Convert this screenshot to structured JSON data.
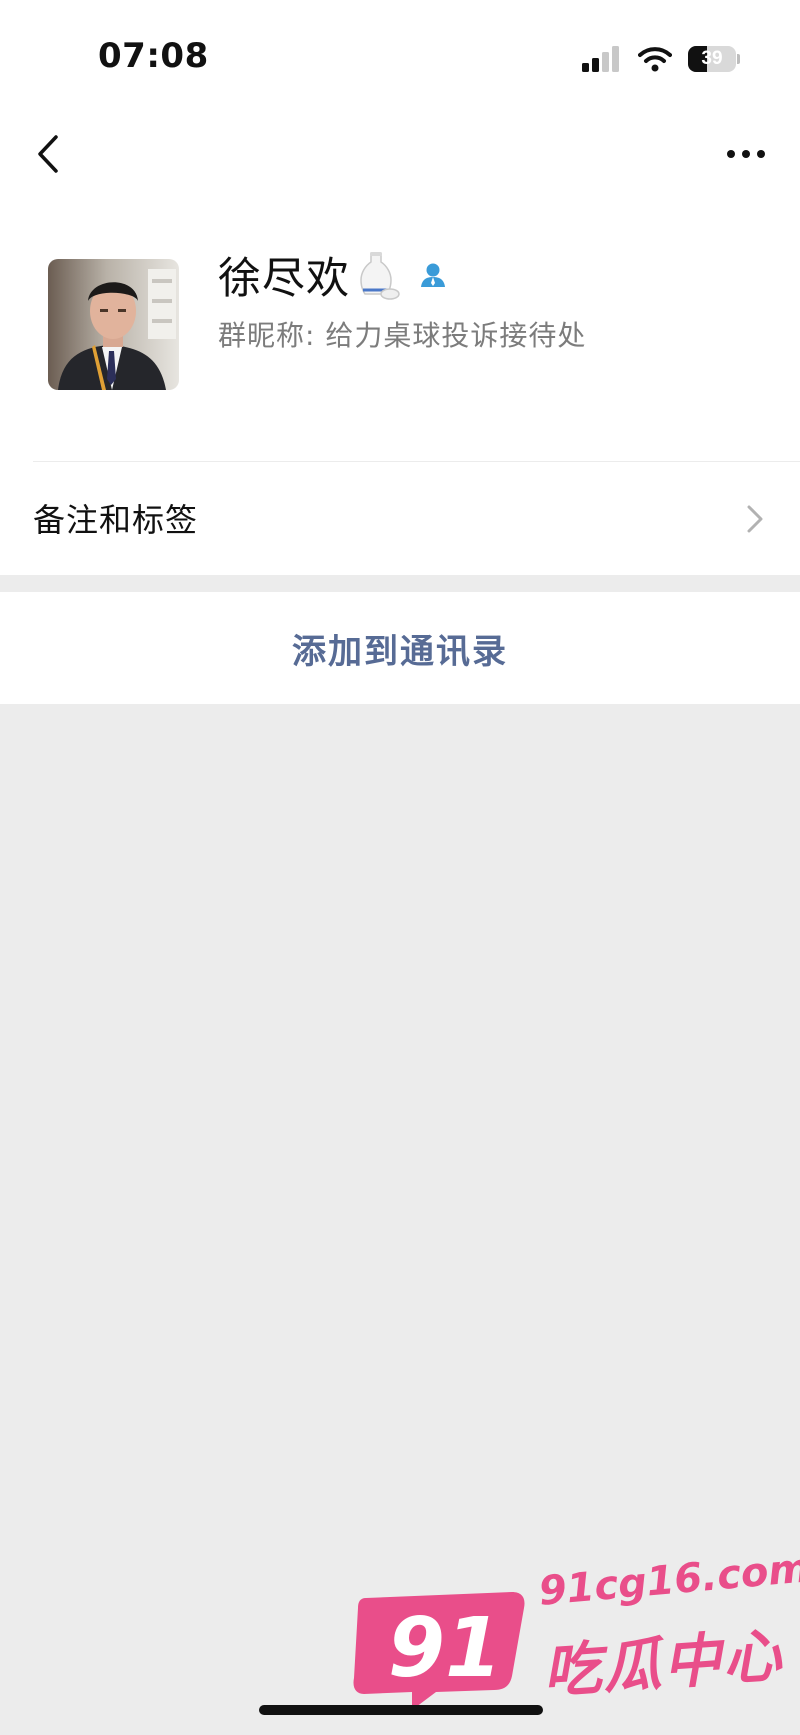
{
  "status_bar": {
    "time": "07:08",
    "battery": "39"
  },
  "profile": {
    "name": "徐尽欢",
    "group_nickname": "群昵称: 给力桌球投诉接待处"
  },
  "remark_tags": {
    "label": "备注和标签"
  },
  "actions": {
    "add_to_contacts": "添加到通讯录"
  },
  "watermark": {
    "number": "91",
    "site": "91cg16.com",
    "text": "吃瓜中心"
  },
  "colors": {
    "link": "#576b95",
    "watermark_pink": "#e94e8a",
    "background": "#ececec"
  }
}
